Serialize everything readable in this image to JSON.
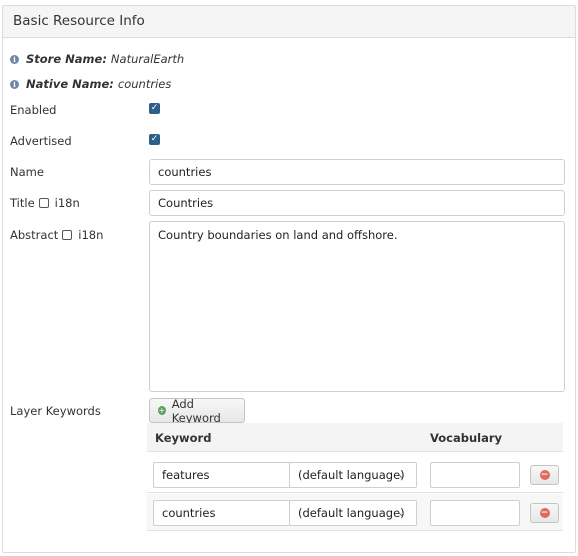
{
  "panel": {
    "title": "Basic Resource Info"
  },
  "store": {
    "label": "Store Name:",
    "value": "NaturalEarth"
  },
  "native": {
    "label": "Native Name:",
    "value": "countries"
  },
  "fields": {
    "enabled_label": "Enabled",
    "enabled_checked": true,
    "advertised_label": "Advertised",
    "advertised_checked": true,
    "name_label": "Name",
    "name_value": "countries",
    "title_label": "Title",
    "title_i18n": "i18n",
    "title_value": "Countries",
    "abstract_label": "Abstract",
    "abstract_i18n": "i18n",
    "abstract_value": "Country boundaries on land and offshore."
  },
  "keywords": {
    "section_label": "Layer Keywords",
    "add_button": "Add Keyword",
    "col_keyword": "Keyword",
    "col_vocabulary": "Vocabulary",
    "rows": [
      {
        "keyword": "features",
        "language": "(default language)",
        "vocabulary": ""
      },
      {
        "keyword": "countries",
        "language": "(default language)",
        "vocabulary": ""
      }
    ]
  }
}
